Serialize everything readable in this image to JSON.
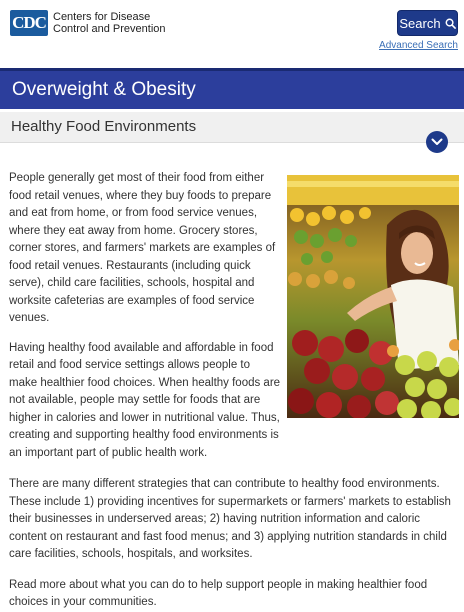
{
  "header": {
    "logo_mark": "CDC",
    "logo_line1": "Centers for Disease",
    "logo_line2": "Control and Prevention",
    "search_label": "Search",
    "advanced_search": "Advanced Search"
  },
  "page_title": "Overweight & Obesity",
  "section_title": "Healthy Food Environments",
  "content": {
    "paragraph1": "People generally get most of their food from either food retail venues, where they buy foods to prepare and eat from home, or from food service venues, where they eat away from home. Grocery stores, corner stores, and farmers' markets are examples of food retail venues. Restaurants (including quick serve), child care facilities, schools, hospital and worksite cafeterias are examples of food service venues.",
    "paragraph2": "Having healthy food available and affordable in food retail and food service settings allows people to make healthier food choices. When healthy foods are not available, people may settle for foods that are higher in calories and lower in nutritional value. Thus, creating and supporting healthy food environments is an important part of public health work.",
    "paragraph3": "There are many different strategies that can contribute to healthy food environments. These include 1) providing incentives for supermarkets or farmers' markets to establish their businesses in underserved areas; 2) having nutrition information and caloric content on restaurant and fast food menus; and 3) applying nutrition standards in child care facilities, schools, hospitals, and worksites.",
    "paragraph4": "Read more about what you can do to help support people in making healthier food choices in your communities."
  },
  "colors": {
    "brand_blue": "#1e3a8a",
    "title_bar": "#2c3e9c",
    "link": "#3b6fb6"
  },
  "icons": [
    "search-icon",
    "chevron-down-icon"
  ]
}
